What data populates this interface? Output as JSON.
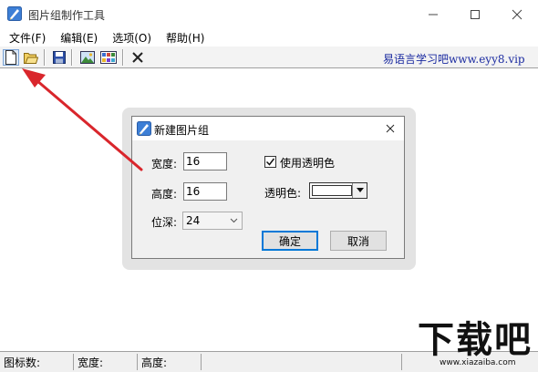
{
  "window": {
    "title": "图片组制作工具",
    "controls": {
      "minimize": "—",
      "maximize": "☐",
      "close": "✕"
    }
  },
  "menu": {
    "items": [
      "文件(F)",
      "编辑(E)",
      "选项(O)",
      "帮助(H)"
    ]
  },
  "toolbar": {
    "buttons": [
      "new-file-icon",
      "open-folder-icon",
      "save-icon",
      "image-icon",
      "image-grid-icon",
      "delete-icon"
    ],
    "site_text": "易语言学习吧www.eyy8.vip"
  },
  "dialog": {
    "title": "新建图片组",
    "width_label": "宽度:",
    "width_value": "16",
    "height_label": "高度:",
    "height_value": "16",
    "depth_label": "位深:",
    "depth_value": "24",
    "use_transparent_label": "使用透明色",
    "use_transparent_checked": true,
    "transparent_color_label": "透明色:",
    "transparent_color": "#ffffff",
    "ok_label": "确定",
    "cancel_label": "取消"
  },
  "status": {
    "icon_count_label": "图标数:",
    "width_label": "宽度:",
    "height_label": "高度:"
  },
  "watermark": {
    "text": "下载吧",
    "url": "www.xiazaiba.com"
  },
  "colors": {
    "arrow": "#d9262c",
    "accent": "#0078d7",
    "site_text": "#1a2aa0"
  }
}
